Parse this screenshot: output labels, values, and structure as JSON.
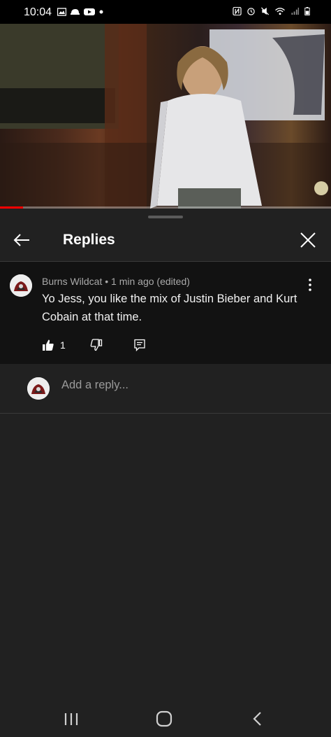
{
  "status_bar": {
    "time": "10:04"
  },
  "video": {
    "progress_percent": 7
  },
  "header": {
    "title": "Replies"
  },
  "comment": {
    "author": "Burns Wildcat",
    "separator": " • ",
    "time_ago": "1 min ago (edited)",
    "text": "Yo Jess, you like the mix of Justin Bieber and Kurt Cobain at that time.",
    "like_count": "1"
  },
  "reply": {
    "placeholder": "Add a reply..."
  },
  "colors": {
    "background": "#212121",
    "comment_bg": "#121212",
    "accent": "#ff0000"
  }
}
